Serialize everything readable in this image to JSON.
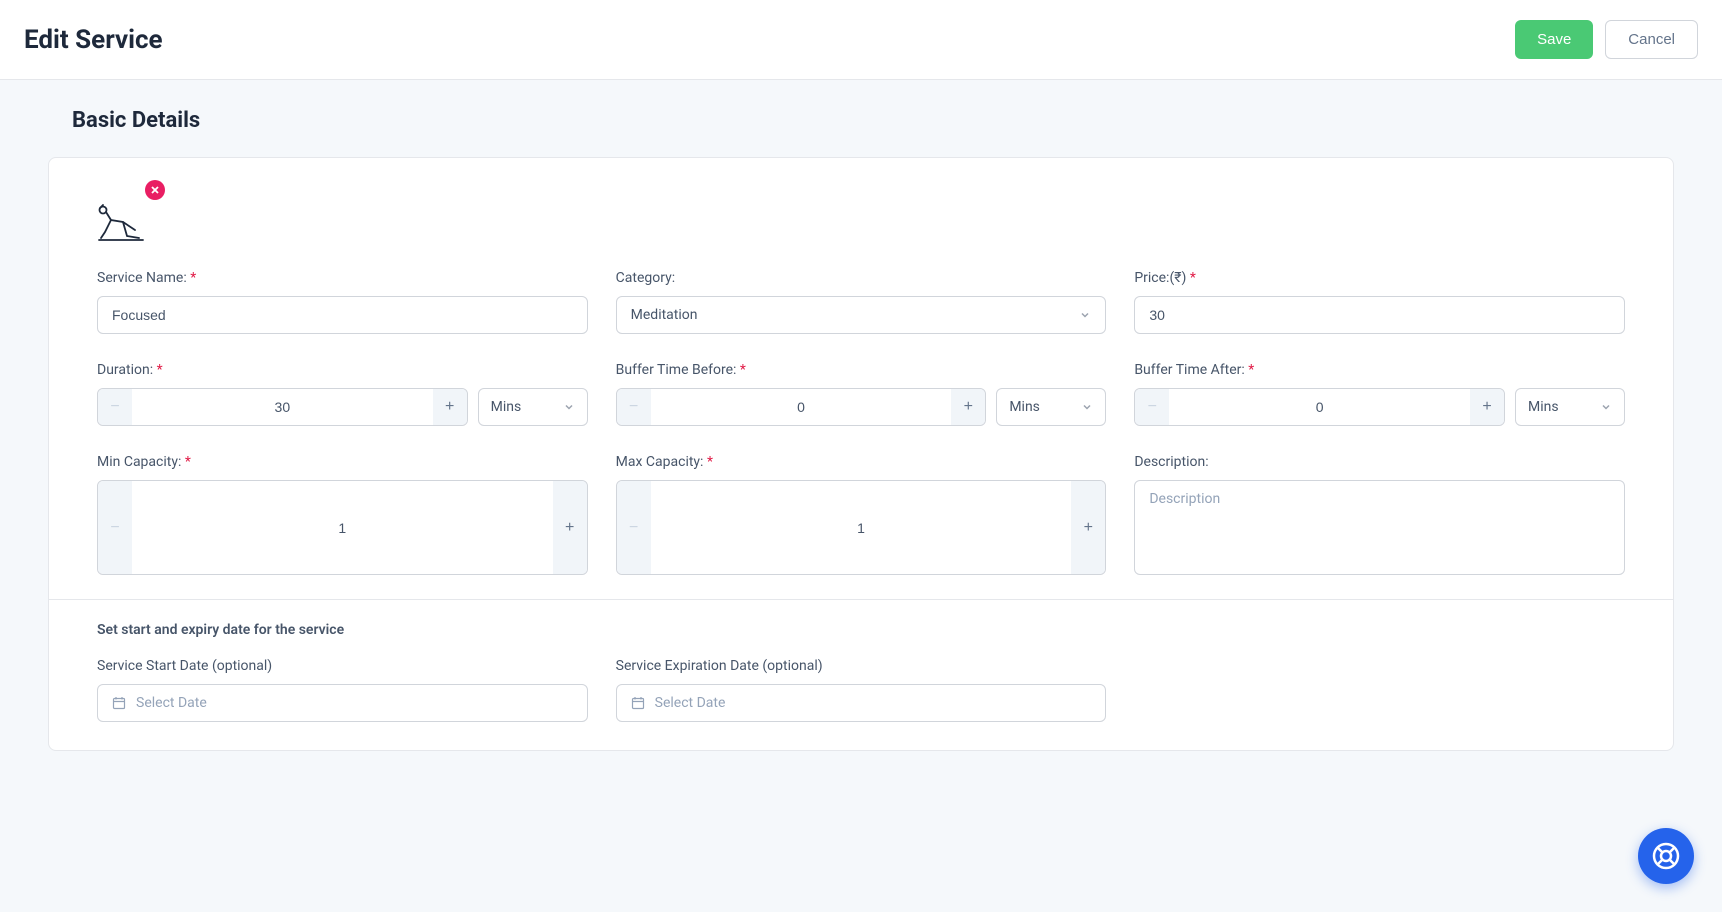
{
  "header": {
    "title": "Edit Service",
    "save_label": "Save",
    "cancel_label": "Cancel"
  },
  "section": {
    "title": "Basic Details",
    "date_section_title": "Set start and expiry date for the service"
  },
  "fields": {
    "service_name": {
      "label": "Service Name:",
      "value": "Focused"
    },
    "category": {
      "label": "Category:",
      "value": "Meditation"
    },
    "price": {
      "label": "Price:(₹)",
      "value": "30"
    },
    "duration": {
      "label": "Duration:",
      "value": "30",
      "unit": "Mins"
    },
    "buffer_before": {
      "label": "Buffer Time Before:",
      "value": "0",
      "unit": "Mins"
    },
    "buffer_after": {
      "label": "Buffer Time After:",
      "value": "0",
      "unit": "Mins"
    },
    "min_capacity": {
      "label": "Min Capacity:",
      "value": "1"
    },
    "max_capacity": {
      "label": "Max Capacity:",
      "value": "1"
    },
    "description": {
      "label": "Description:",
      "placeholder": "Description",
      "value": ""
    },
    "start_date": {
      "label": "Service Start Date (optional)",
      "placeholder": "Select Date"
    },
    "expiration_date": {
      "label": "Service Expiration Date (optional)",
      "placeholder": "Select Date"
    }
  },
  "required_mark": "*",
  "icons": {
    "remove": "close-icon",
    "service_image": "yoga-stretch-icon"
  }
}
